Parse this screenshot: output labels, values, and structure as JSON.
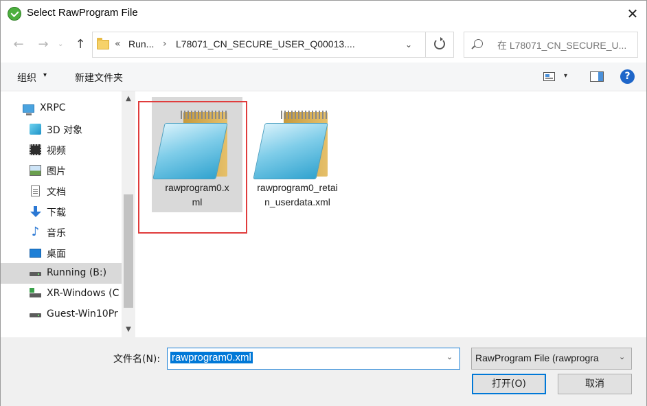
{
  "window": {
    "title": "Select RawProgram File",
    "close_glyph": "✕",
    "title_icon": "download-arrow-icon"
  },
  "nav": {
    "back_glyph": "←",
    "forward_glyph": "→",
    "up_glyph": "↑",
    "recent_glyph": "⌄",
    "address": {
      "overflow": "«",
      "segments": [
        "Run...",
        "L78071_CN_SECURE_USER_Q00013...."
      ],
      "separator": "›",
      "dropdown_glyph": "⌄"
    },
    "search_placeholder": "在 L78071_CN_SECURE_U..."
  },
  "toolbar": {
    "organize_label": "组织",
    "organize_arrow": "▾",
    "new_folder_label": "新建文件夹",
    "view_arrow": "▾",
    "help_glyph": "?"
  },
  "sidebar": {
    "items": [
      {
        "label": "XRPC",
        "icon": "computer-icon"
      },
      {
        "label": "3D 对象",
        "icon": "3d-objects-icon"
      },
      {
        "label": "视频",
        "icon": "video-icon"
      },
      {
        "label": "图片",
        "icon": "pictures-icon"
      },
      {
        "label": "文档",
        "icon": "documents-icon"
      },
      {
        "label": "下载",
        "icon": "downloads-icon"
      },
      {
        "label": "音乐",
        "icon": "music-icon"
      },
      {
        "label": "桌面",
        "icon": "desktop-icon"
      },
      {
        "label": "Running (B:)",
        "icon": "drive-icon",
        "selected": true
      },
      {
        "label": "XR-Windows (C",
        "icon": "windows-drive-icon"
      },
      {
        "label": "Guest-Win10Pr",
        "icon": "drive-icon"
      }
    ],
    "music_glyph": "♪",
    "scroll_up_glyph": "▲",
    "scroll_down_glyph": "▼"
  },
  "files": [
    {
      "name": "rawprogram0.xml",
      "display": "rawprogram0.x\nml",
      "icon": "notepad-file-icon",
      "highlighted": true
    },
    {
      "name": "rawprogram0_retain_userdata.xml",
      "display": "rawprogram0_r\netain_userdata.\nxml",
      "icon": "notepad-file-icon",
      "highlighted": false
    }
  ],
  "bottom": {
    "filename_label": "文件名(N):",
    "filename_value": "rawprogram0.xml",
    "filter_value": "RawProgram File (rawprogra",
    "dropdown_glyph": "⌄",
    "open_label": "打开(O)",
    "cancel_label": "取消"
  },
  "colors": {
    "accent": "#0078d7",
    "highlight_box": "#e03c3c",
    "selection": "#d9d9d9"
  }
}
